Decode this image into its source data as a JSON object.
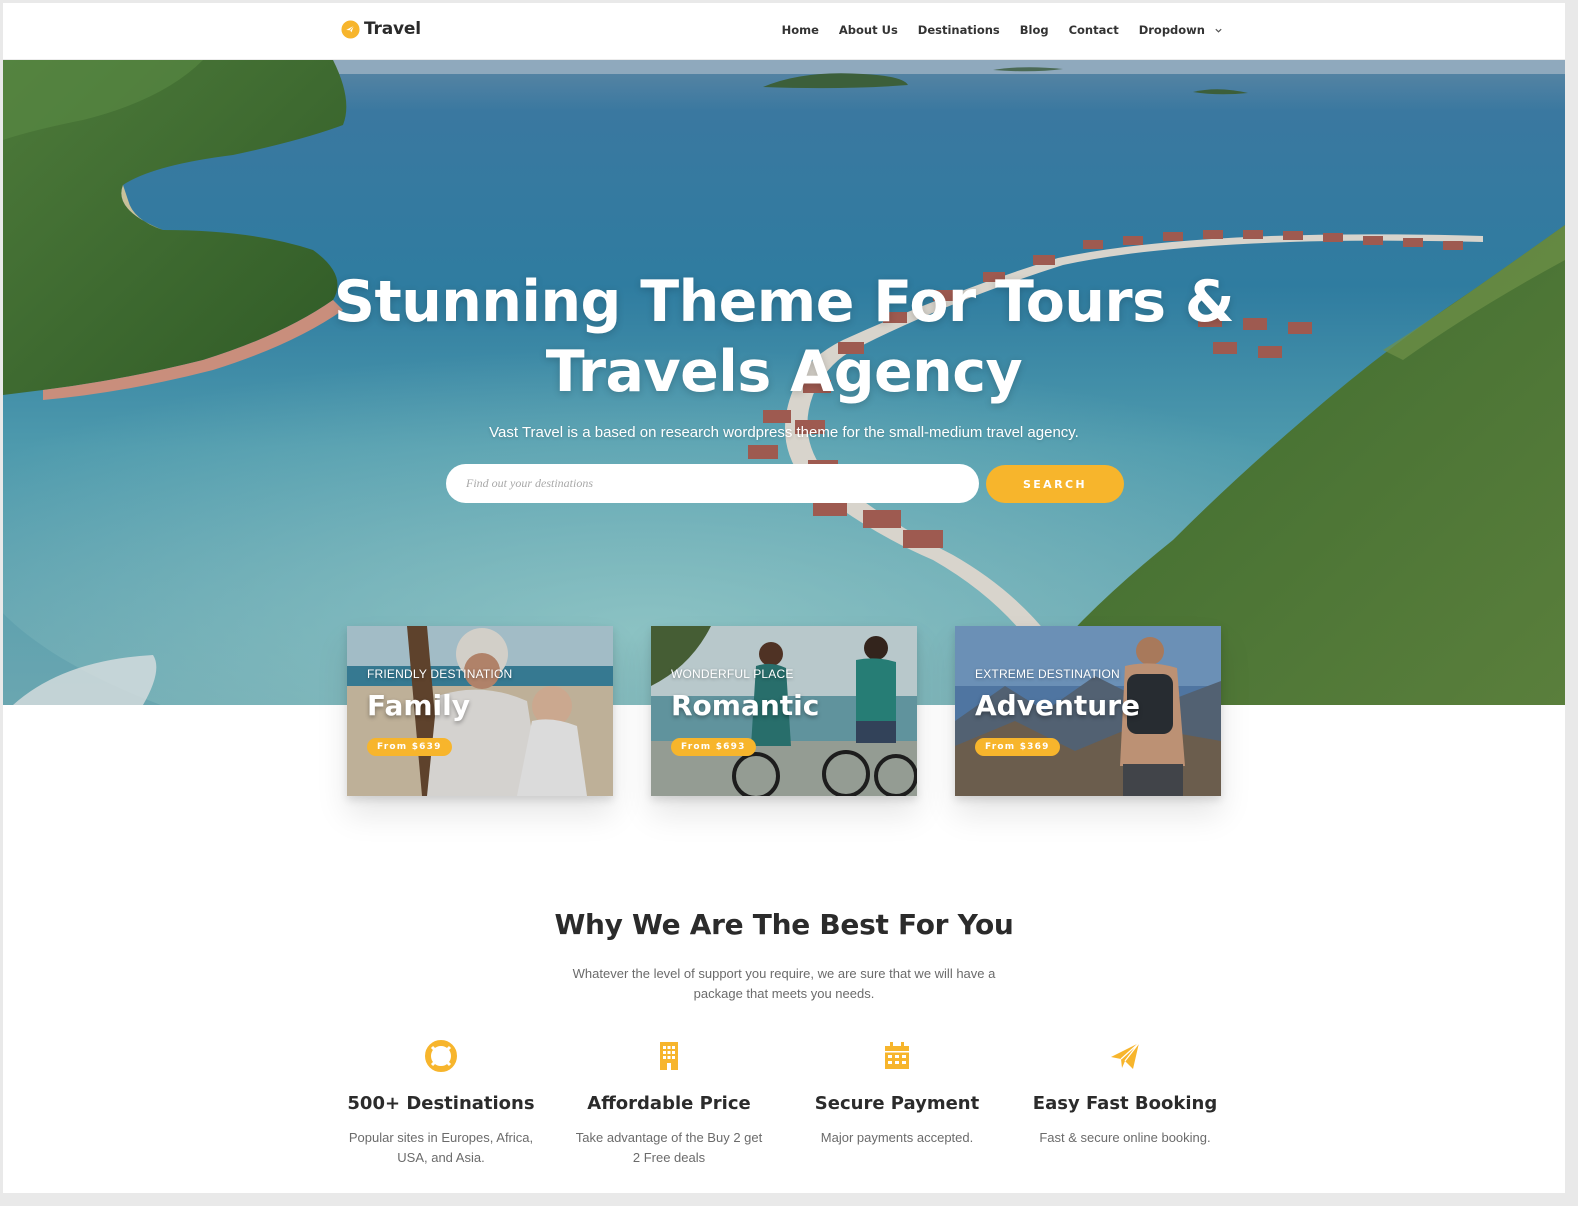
{
  "site": {
    "logo_text": "Travel",
    "accent_color": "#f7b52c"
  },
  "nav": {
    "items": [
      "Home",
      "About Us",
      "Destinations",
      "Blog",
      "Contact"
    ],
    "dropdown_label": "Dropdown"
  },
  "hero": {
    "title_line1": "Stunning Theme For Tours &",
    "title_line2": "Travels Agency",
    "subtitle": "Vast Travel is a based on research wordpress theme for the small-medium travel agency.",
    "search_placeholder": "Find out your destinations",
    "search_value": "",
    "search_button": "SEARCH"
  },
  "cards": [
    {
      "eyebrow": "FRIENDLY DESTINATION",
      "title": "Family",
      "price": "From $639"
    },
    {
      "eyebrow": "WONDERFUL PLACE",
      "title": "Romantic",
      "price": "From $693"
    },
    {
      "eyebrow": "EXTREME DESTINATION",
      "title": "Adventure",
      "price": "From $369"
    }
  ],
  "why": {
    "title": "Why We Are The Best For You",
    "description": "Whatever the level of support you require, we are sure that we will have a package that meets you needs."
  },
  "features": [
    {
      "icon": "lifebuoy-icon",
      "title": "500+ Destinations",
      "text": "Popular sites in Europes, Africa, USA, and Asia."
    },
    {
      "icon": "building-icon",
      "title": "Affordable Price",
      "text": "Take advantage of the Buy 2 get 2 Free deals"
    },
    {
      "icon": "calendar-icon",
      "title": "Secure Payment",
      "text": "Major payments accepted."
    },
    {
      "icon": "paper-plane-icon",
      "title": "Easy Fast Booking",
      "text": "Fast & secure online booking."
    }
  ]
}
